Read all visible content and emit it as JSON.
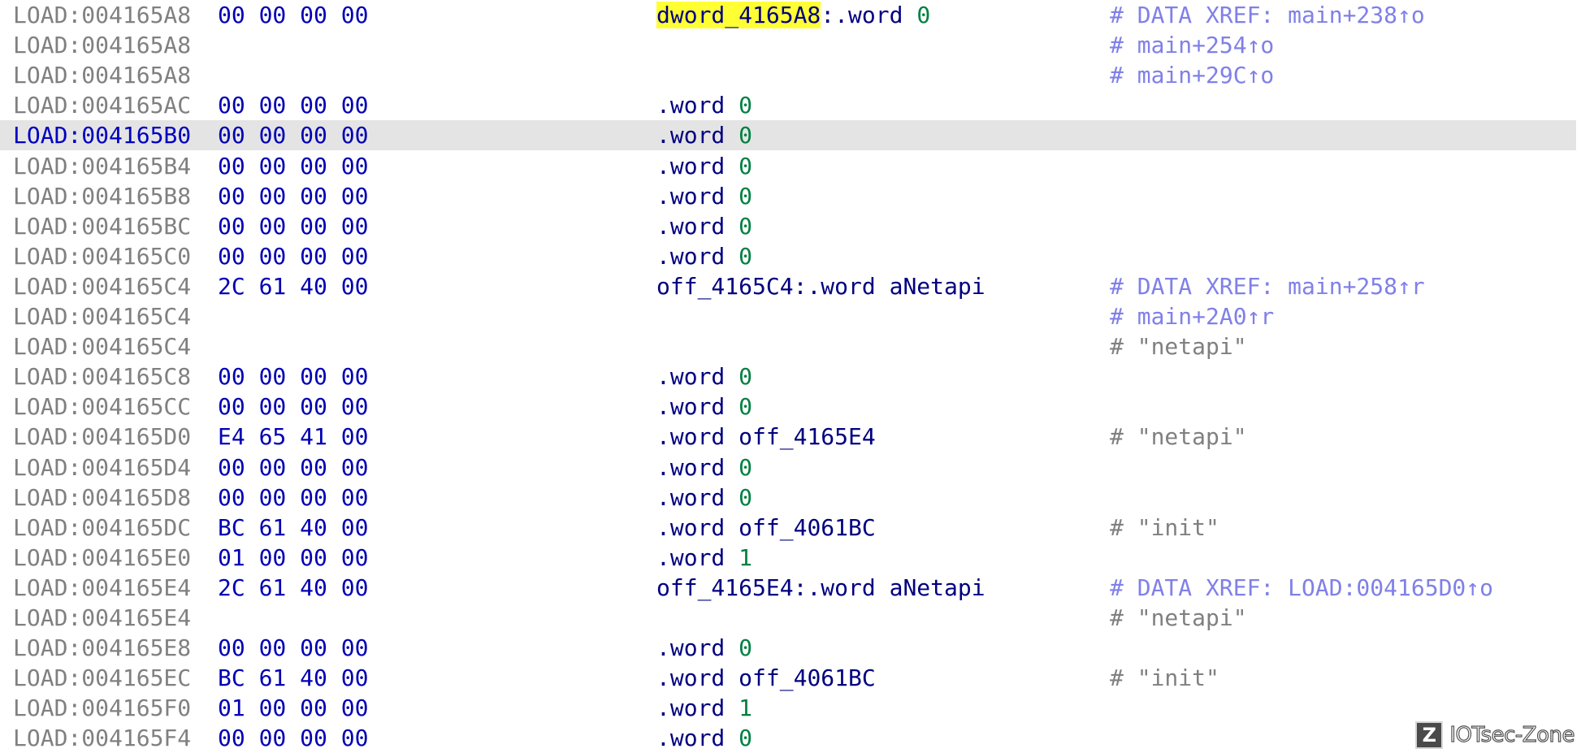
{
  "rows": [
    {
      "addr": "LOAD:004165A8",
      "bytes": "00 00 00 00",
      "label": "dword_4165A8",
      "sep": ":",
      "mnem": ".word",
      "op": "0",
      "op_type": "num",
      "comment": "# DATA XREF: main+238↑o",
      "comment_type": "xref",
      "highlight": true,
      "current": false
    },
    {
      "addr": "LOAD:004165A8",
      "bytes": "",
      "label": "",
      "sep": "",
      "mnem": "",
      "op": "",
      "op_type": "",
      "comment": "# main+254↑o",
      "comment_type": "xref",
      "highlight": false,
      "current": false
    },
    {
      "addr": "LOAD:004165A8",
      "bytes": "",
      "label": "",
      "sep": "",
      "mnem": "",
      "op": "",
      "op_type": "",
      "comment": "# main+29C↑o",
      "comment_type": "xref",
      "highlight": false,
      "current": false
    },
    {
      "addr": "LOAD:004165AC",
      "bytes": "00 00 00 00",
      "label": "",
      "sep": "",
      "mnem": ".word",
      "op": "0",
      "op_type": "num",
      "comment": "",
      "comment_type": "",
      "highlight": false,
      "current": false
    },
    {
      "addr": "LOAD:004165B0",
      "bytes": "00 00 00 00",
      "label": "",
      "sep": "",
      "mnem": ".word",
      "op": "0",
      "op_type": "num",
      "comment": "",
      "comment_type": "",
      "highlight": false,
      "current": true
    },
    {
      "addr": "LOAD:004165B4",
      "bytes": "00 00 00 00",
      "label": "",
      "sep": "",
      "mnem": ".word",
      "op": "0",
      "op_type": "num",
      "comment": "",
      "comment_type": "",
      "highlight": false,
      "current": false
    },
    {
      "addr": "LOAD:004165B8",
      "bytes": "00 00 00 00",
      "label": "",
      "sep": "",
      "mnem": ".word",
      "op": "0",
      "op_type": "num",
      "comment": "",
      "comment_type": "",
      "highlight": false,
      "current": false
    },
    {
      "addr": "LOAD:004165BC",
      "bytes": "00 00 00 00",
      "label": "",
      "sep": "",
      "mnem": ".word",
      "op": "0",
      "op_type": "num",
      "comment": "",
      "comment_type": "",
      "highlight": false,
      "current": false
    },
    {
      "addr": "LOAD:004165C0",
      "bytes": "00 00 00 00",
      "label": "",
      "sep": "",
      "mnem": ".word",
      "op": "0",
      "op_type": "num",
      "comment": "",
      "comment_type": "",
      "highlight": false,
      "current": false
    },
    {
      "addr": "LOAD:004165C4",
      "bytes": "2C 61 40 00",
      "label": "off_4165C4",
      "sep": ":",
      "mnem": ".word",
      "op": "aNetapi",
      "op_type": "sym",
      "comment": "# DATA XREF: main+258↑r",
      "comment_type": "xref",
      "highlight": false,
      "current": false
    },
    {
      "addr": "LOAD:004165C4",
      "bytes": "",
      "label": "",
      "sep": "",
      "mnem": "",
      "op": "",
      "op_type": "",
      "comment": "# main+2A0↑r",
      "comment_type": "xref",
      "highlight": false,
      "current": false
    },
    {
      "addr": "LOAD:004165C4",
      "bytes": "",
      "label": "",
      "sep": "",
      "mnem": "",
      "op": "",
      "op_type": "",
      "comment": "# \"netapi\"",
      "comment_type": "str",
      "highlight": false,
      "current": false
    },
    {
      "addr": "LOAD:004165C8",
      "bytes": "00 00 00 00",
      "label": "",
      "sep": "",
      "mnem": ".word",
      "op": "0",
      "op_type": "num",
      "comment": "",
      "comment_type": "",
      "highlight": false,
      "current": false
    },
    {
      "addr": "LOAD:004165CC",
      "bytes": "00 00 00 00",
      "label": "",
      "sep": "",
      "mnem": ".word",
      "op": "0",
      "op_type": "num",
      "comment": "",
      "comment_type": "",
      "highlight": false,
      "current": false
    },
    {
      "addr": "LOAD:004165D0",
      "bytes": "E4 65 41 00",
      "label": "",
      "sep": "",
      "mnem": ".word",
      "op": "off_4165E4",
      "op_type": "sym",
      "comment": "# \"netapi\"",
      "comment_type": "str",
      "highlight": false,
      "current": false
    },
    {
      "addr": "LOAD:004165D4",
      "bytes": "00 00 00 00",
      "label": "",
      "sep": "",
      "mnem": ".word",
      "op": "0",
      "op_type": "num",
      "comment": "",
      "comment_type": "",
      "highlight": false,
      "current": false
    },
    {
      "addr": "LOAD:004165D8",
      "bytes": "00 00 00 00",
      "label": "",
      "sep": "",
      "mnem": ".word",
      "op": "0",
      "op_type": "num",
      "comment": "",
      "comment_type": "",
      "highlight": false,
      "current": false
    },
    {
      "addr": "LOAD:004165DC",
      "bytes": "BC 61 40 00",
      "label": "",
      "sep": "",
      "mnem": ".word",
      "op": "off_4061BC",
      "op_type": "sym",
      "comment": "# \"init\"",
      "comment_type": "str",
      "highlight": false,
      "current": false
    },
    {
      "addr": "LOAD:004165E0",
      "bytes": "01 00 00 00",
      "label": "",
      "sep": "",
      "mnem": ".word",
      "op": "1",
      "op_type": "num",
      "comment": "",
      "comment_type": "",
      "highlight": false,
      "current": false
    },
    {
      "addr": "LOAD:004165E4",
      "bytes": "2C 61 40 00",
      "label": "off_4165E4",
      "sep": ":",
      "mnem": ".word",
      "op": "aNetapi",
      "op_type": "sym",
      "comment": "# DATA XREF: LOAD:004165D0↑o",
      "comment_type": "xref",
      "highlight": false,
      "current": false
    },
    {
      "addr": "LOAD:004165E4",
      "bytes": "",
      "label": "",
      "sep": "",
      "mnem": "",
      "op": "",
      "op_type": "",
      "comment": "# \"netapi\"",
      "comment_type": "str",
      "highlight": false,
      "current": false
    },
    {
      "addr": "LOAD:004165E8",
      "bytes": "00 00 00 00",
      "label": "",
      "sep": "",
      "mnem": ".word",
      "op": "0",
      "op_type": "num",
      "comment": "",
      "comment_type": "",
      "highlight": false,
      "current": false
    },
    {
      "addr": "LOAD:004165EC",
      "bytes": "BC 61 40 00",
      "label": "",
      "sep": "",
      "mnem": ".word",
      "op": "off_4061BC",
      "op_type": "sym",
      "comment": "# \"init\"",
      "comment_type": "str",
      "highlight": false,
      "current": false
    },
    {
      "addr": "LOAD:004165F0",
      "bytes": "01 00 00 00",
      "label": "",
      "sep": "",
      "mnem": ".word",
      "op": "1",
      "op_type": "num",
      "comment": "",
      "comment_type": "",
      "highlight": false,
      "current": false
    },
    {
      "addr": "LOAD:004165F4",
      "bytes": "00 00 00 00",
      "label": "",
      "sep": "",
      "mnem": ".word",
      "op": "0",
      "op_type": "num",
      "comment": "",
      "comment_type": "",
      "highlight": false,
      "current": false
    }
  ],
  "watermark": {
    "icon_letter": "Z",
    "text": "IOTsec-Zone"
  },
  "colors": {
    "address": "#808080",
    "current_address": "#0000c0",
    "bytes": "#0000b4",
    "mnemonic": "#000080",
    "number": "#008040",
    "xref_comment": "#8080e8",
    "string_comment": "#808080",
    "highlight": "#ffff33",
    "current_line": "#e4e4e4"
  }
}
